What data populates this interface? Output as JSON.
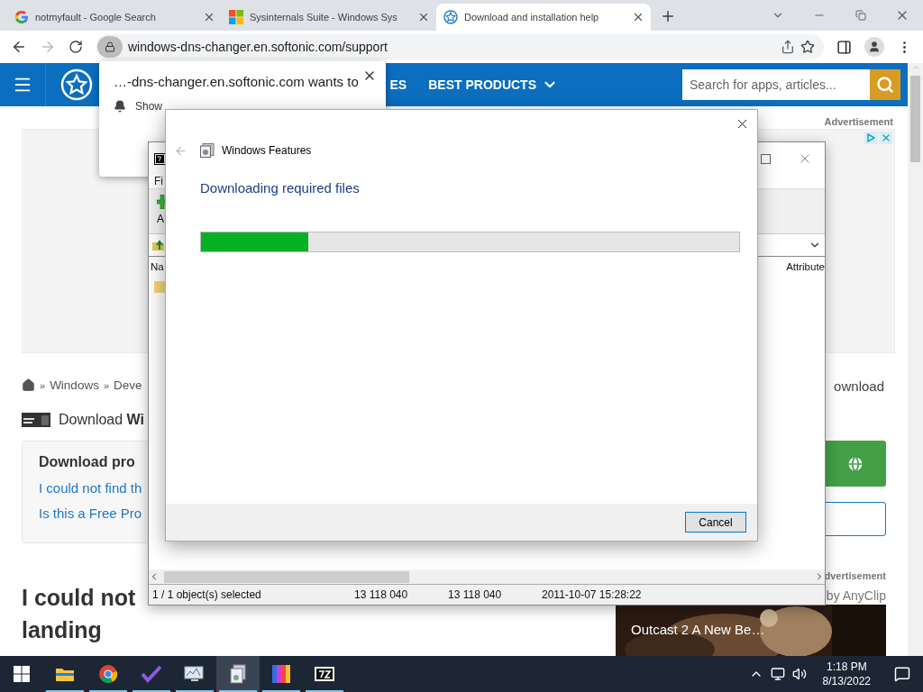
{
  "browser": {
    "tabs": [
      {
        "title": "notmyfault - Google Search",
        "selected": false
      },
      {
        "title": "Sysinternals Suite - Windows Sys",
        "selected": false
      },
      {
        "title": "Download and installation help",
        "selected": true
      }
    ],
    "url": "windows-dns-changer.en.softonic.com/support"
  },
  "site": {
    "nav": [
      "ES",
      "BEST PRODUCTS"
    ],
    "search": {
      "placeholder": "Search for apps, articles..."
    },
    "ad_label": "Advertisement",
    "breadcrumb": [
      {
        "kind": "separator",
        "text": "»"
      },
      {
        "kind": "link",
        "text": "Windows"
      },
      {
        "kind": "separator",
        "text": "»"
      },
      {
        "kind": "link",
        "text": "Deve"
      }
    ],
    "breadcrumb_tail": "ownload",
    "download_title": "Download **Wi**",
    "problems": {
      "title": "Download pro",
      "links": [
        "I could not find th",
        "Is this a Free Pro"
      ]
    },
    "heading": [
      "I could not",
      "landing"
    ],
    "video": {
      "ad_label": "dvertisement",
      "credit": "by AnyClip",
      "title": "Outcast 2 A New Be…"
    }
  },
  "notification": {
    "text": "…-dns-changer.en.softonic.com wants to",
    "option": "Show"
  },
  "archiver": {
    "menu": "Fi",
    "toolbar": "A",
    "columns": [
      "Na",
      "Attribute"
    ],
    "status": [
      "1 / 1 object(s) selected",
      "13 118 040",
      "13 118 040",
      "2011-10-07 15:28:22"
    ]
  },
  "dialog": {
    "title": "Windows Features",
    "heading": "Downloading required files",
    "progress": {
      "level": 0.2
    },
    "buttons": [
      "Cancel"
    ]
  },
  "taskbar": {
    "apps": [
      {
        "kind": "explorer",
        "running": true,
        "selected": false
      },
      {
        "kind": "chrome",
        "running": true,
        "selected": false
      },
      {
        "kind": "check",
        "running": true,
        "selected": false
      },
      {
        "kind": "monitor",
        "running": true,
        "selected": false
      },
      {
        "kind": "features",
        "running": true,
        "selected": true
      },
      {
        "kind": "bars",
        "running": true,
        "selected": false
      },
      {
        "kind": "archive",
        "running": true,
        "selected": false
      }
    ],
    "clock": {
      "time": "1:18 PM",
      "date": "8/13/2022"
    }
  }
}
